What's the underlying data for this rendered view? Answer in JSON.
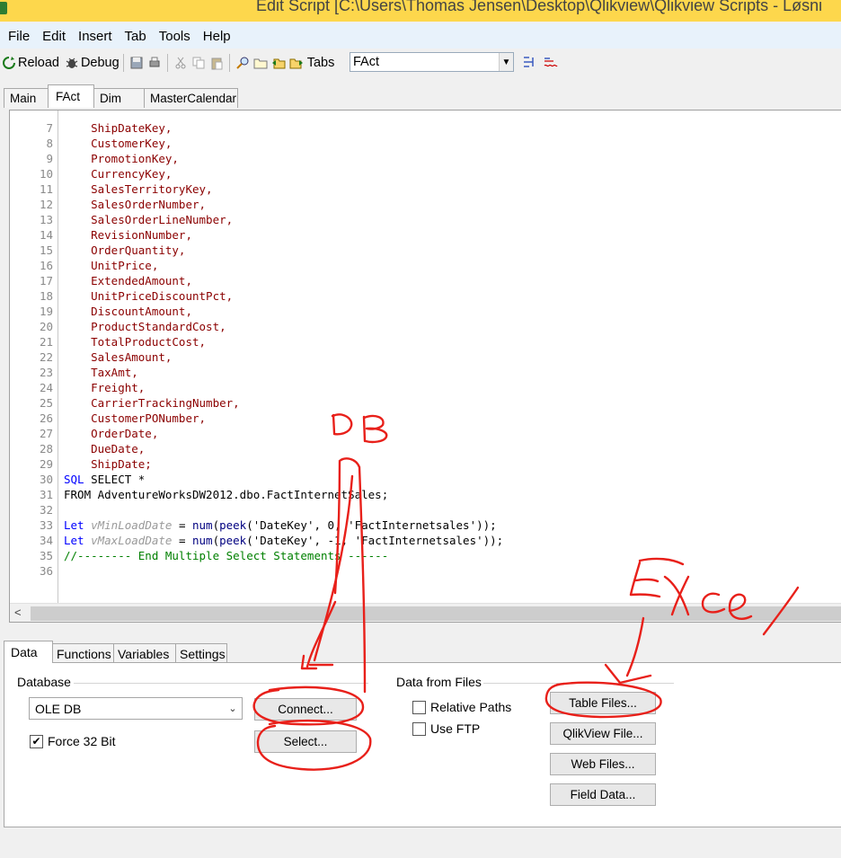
{
  "window": {
    "title": "Edit Script [C:\\Users\\Thomas Jensen\\Desktop\\Qlikview\\Qlikview Scripts - Løsni"
  },
  "menu": [
    "File",
    "Edit",
    "Insert",
    "Tab",
    "Tools",
    "Help"
  ],
  "toolbar": {
    "reload": "Reload",
    "debug": "Debug",
    "tabs": "Tabs",
    "tab_value": "FAct"
  },
  "script_tabs": [
    "Main",
    "FAct",
    "Dim",
    "MasterCalendar"
  ],
  "editor": {
    "lines": [
      {
        "n": "7",
        "parts": [
          {
            "t": "    ShipDateKey,",
            "c": "c-field"
          }
        ]
      },
      {
        "n": "8",
        "parts": [
          {
            "t": "    CustomerKey,",
            "c": "c-field"
          }
        ]
      },
      {
        "n": "9",
        "parts": [
          {
            "t": "    PromotionKey,",
            "c": "c-field"
          }
        ]
      },
      {
        "n": "10",
        "parts": [
          {
            "t": "    CurrencyKey,",
            "c": "c-field"
          }
        ]
      },
      {
        "n": "11",
        "parts": [
          {
            "t": "    SalesTerritoryKey,",
            "c": "c-field"
          }
        ]
      },
      {
        "n": "12",
        "parts": [
          {
            "t": "    SalesOrderNumber,",
            "c": "c-field"
          }
        ]
      },
      {
        "n": "13",
        "parts": [
          {
            "t": "    SalesOrderLineNumber,",
            "c": "c-field"
          }
        ]
      },
      {
        "n": "14",
        "parts": [
          {
            "t": "    RevisionNumber,",
            "c": "c-field"
          }
        ]
      },
      {
        "n": "15",
        "parts": [
          {
            "t": "    OrderQuantity,",
            "c": "c-field"
          }
        ]
      },
      {
        "n": "16",
        "parts": [
          {
            "t": "    UnitPrice,",
            "c": "c-field"
          }
        ]
      },
      {
        "n": "17",
        "parts": [
          {
            "t": "    ExtendedAmount,",
            "c": "c-field"
          }
        ]
      },
      {
        "n": "18",
        "parts": [
          {
            "t": "    UnitPriceDiscountPct,",
            "c": "c-field"
          }
        ]
      },
      {
        "n": "19",
        "parts": [
          {
            "t": "    DiscountAmount,",
            "c": "c-field"
          }
        ]
      },
      {
        "n": "20",
        "parts": [
          {
            "t": "    ProductStandardCost,",
            "c": "c-field"
          }
        ]
      },
      {
        "n": "21",
        "parts": [
          {
            "t": "    TotalProductCost,",
            "c": "c-field"
          }
        ]
      },
      {
        "n": "22",
        "parts": [
          {
            "t": "    SalesAmount,",
            "c": "c-field"
          }
        ]
      },
      {
        "n": "23",
        "parts": [
          {
            "t": "    TaxAmt,",
            "c": "c-field"
          }
        ]
      },
      {
        "n": "24",
        "parts": [
          {
            "t": "    Freight,",
            "c": "c-field"
          }
        ]
      },
      {
        "n": "25",
        "parts": [
          {
            "t": "    CarrierTrackingNumber,",
            "c": "c-field"
          }
        ]
      },
      {
        "n": "26",
        "parts": [
          {
            "t": "    CustomerPONumber,",
            "c": "c-field"
          }
        ]
      },
      {
        "n": "27",
        "parts": [
          {
            "t": "    OrderDate,",
            "c": "c-field"
          }
        ]
      },
      {
        "n": "28",
        "parts": [
          {
            "t": "    DueDate,",
            "c": "c-field"
          }
        ]
      },
      {
        "n": "29",
        "parts": [
          {
            "t": "    ShipDate;",
            "c": "c-field"
          }
        ]
      },
      {
        "n": "30",
        "parts": [
          {
            "t": "SQL",
            "c": "c-kw"
          },
          {
            "t": " SELECT *",
            "c": "c-plain"
          }
        ]
      },
      {
        "n": "31",
        "parts": [
          {
            "t": "FROM AdventureWorksDW2012.dbo.FactInternetSales;",
            "c": "c-plain"
          }
        ]
      },
      {
        "n": "32",
        "parts": []
      },
      {
        "n": "33",
        "parts": [
          {
            "t": "Let",
            "c": "c-kw"
          },
          {
            "t": " ",
            "c": "c-plain"
          },
          {
            "t": "vMinLoadDate",
            "c": "c-var"
          },
          {
            "t": " = ",
            "c": "c-plain"
          },
          {
            "t": "num",
            "c": "c-fn"
          },
          {
            "t": "(",
            "c": "c-plain"
          },
          {
            "t": "peek",
            "c": "c-fn"
          },
          {
            "t": "('DateKey', 0, 'FactInternetsales'));",
            "c": "c-plain"
          }
        ]
      },
      {
        "n": "34",
        "parts": [
          {
            "t": "Let",
            "c": "c-kw"
          },
          {
            "t": " ",
            "c": "c-plain"
          },
          {
            "t": "vMaxLoadDate",
            "c": "c-var"
          },
          {
            "t": " = ",
            "c": "c-plain"
          },
          {
            "t": "num",
            "c": "c-fn"
          },
          {
            "t": "(",
            "c": "c-plain"
          },
          {
            "t": "peek",
            "c": "c-fn"
          },
          {
            "t": "('DateKey', -1, 'FactInternetsales'));",
            "c": "c-plain"
          }
        ]
      },
      {
        "n": "35",
        "parts": [
          {
            "t": "//-------- End Multiple Select Statements ------",
            "c": "c-com"
          }
        ]
      },
      {
        "n": "36",
        "parts": []
      }
    ]
  },
  "bottom_tabs": [
    "Data",
    "Functions",
    "Variables",
    "Settings"
  ],
  "database": {
    "group_label": "Database",
    "selected": "OLE DB",
    "force32_label": "Force 32 Bit",
    "force32_checked": "✔",
    "connect_label": "Connect...",
    "select_label": "Select..."
  },
  "files": {
    "group_label": "Data from Files",
    "relative_paths_label": "Relative Paths",
    "use_ftp_label": "Use FTP",
    "table_files_label": "Table Files...",
    "qlikview_file_label": "QlikView File...",
    "web_files_label": "Web Files...",
    "field_data_label": "Field Data..."
  },
  "colors": {
    "annotation": "#e8201a",
    "title_bar": "#fdd74c",
    "menu_bar": "#e8f2fb"
  }
}
